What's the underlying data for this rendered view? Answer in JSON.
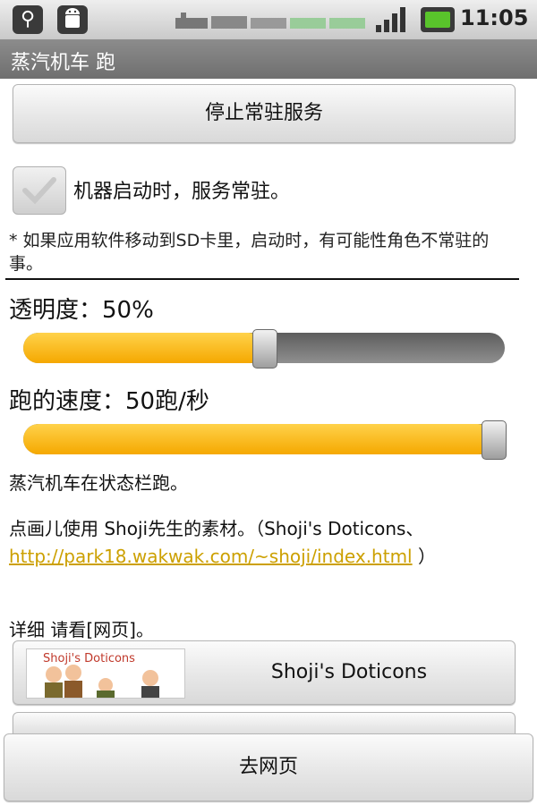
{
  "status_bar": {
    "time": "11:05",
    "icons": [
      "usb-icon",
      "android-icon",
      "train-icon",
      "signal-icon",
      "battery-icon"
    ]
  },
  "title_bar": {
    "title": "蒸汽机车 跑"
  },
  "stop_service_button": "停止常驻服务",
  "autostart": {
    "label": "机器启动时，服务常驻。",
    "checked": true
  },
  "note": "* 如果应用软件移动到SD卡里，启动时，有可能性角色不常驻的事。",
  "opacity": {
    "label": "透明度：50%",
    "value": 50,
    "max": 100
  },
  "speed": {
    "label": "跑的速度：50跑/秒",
    "value": 50,
    "max": 50
  },
  "info_statusbar": "蒸汽机车在状态栏跑。",
  "credits": {
    "prefix": "点画儿使用 Shoji先生的素材。（Shoji's Doticons、",
    "link": "http://park18.wakwak.com/~shoji/index.html",
    "suffix": "）"
  },
  "detail_text": "详细 请看[网页]。",
  "doticons_button": {
    "label": "Shoji's Doticons",
    "image_caption": "Shoji's Doticons"
  },
  "go_web_button": "去网页",
  "colors": {
    "accent": "#f5b400",
    "link": "#cca000",
    "title_bar": "#7a7a7a"
  }
}
